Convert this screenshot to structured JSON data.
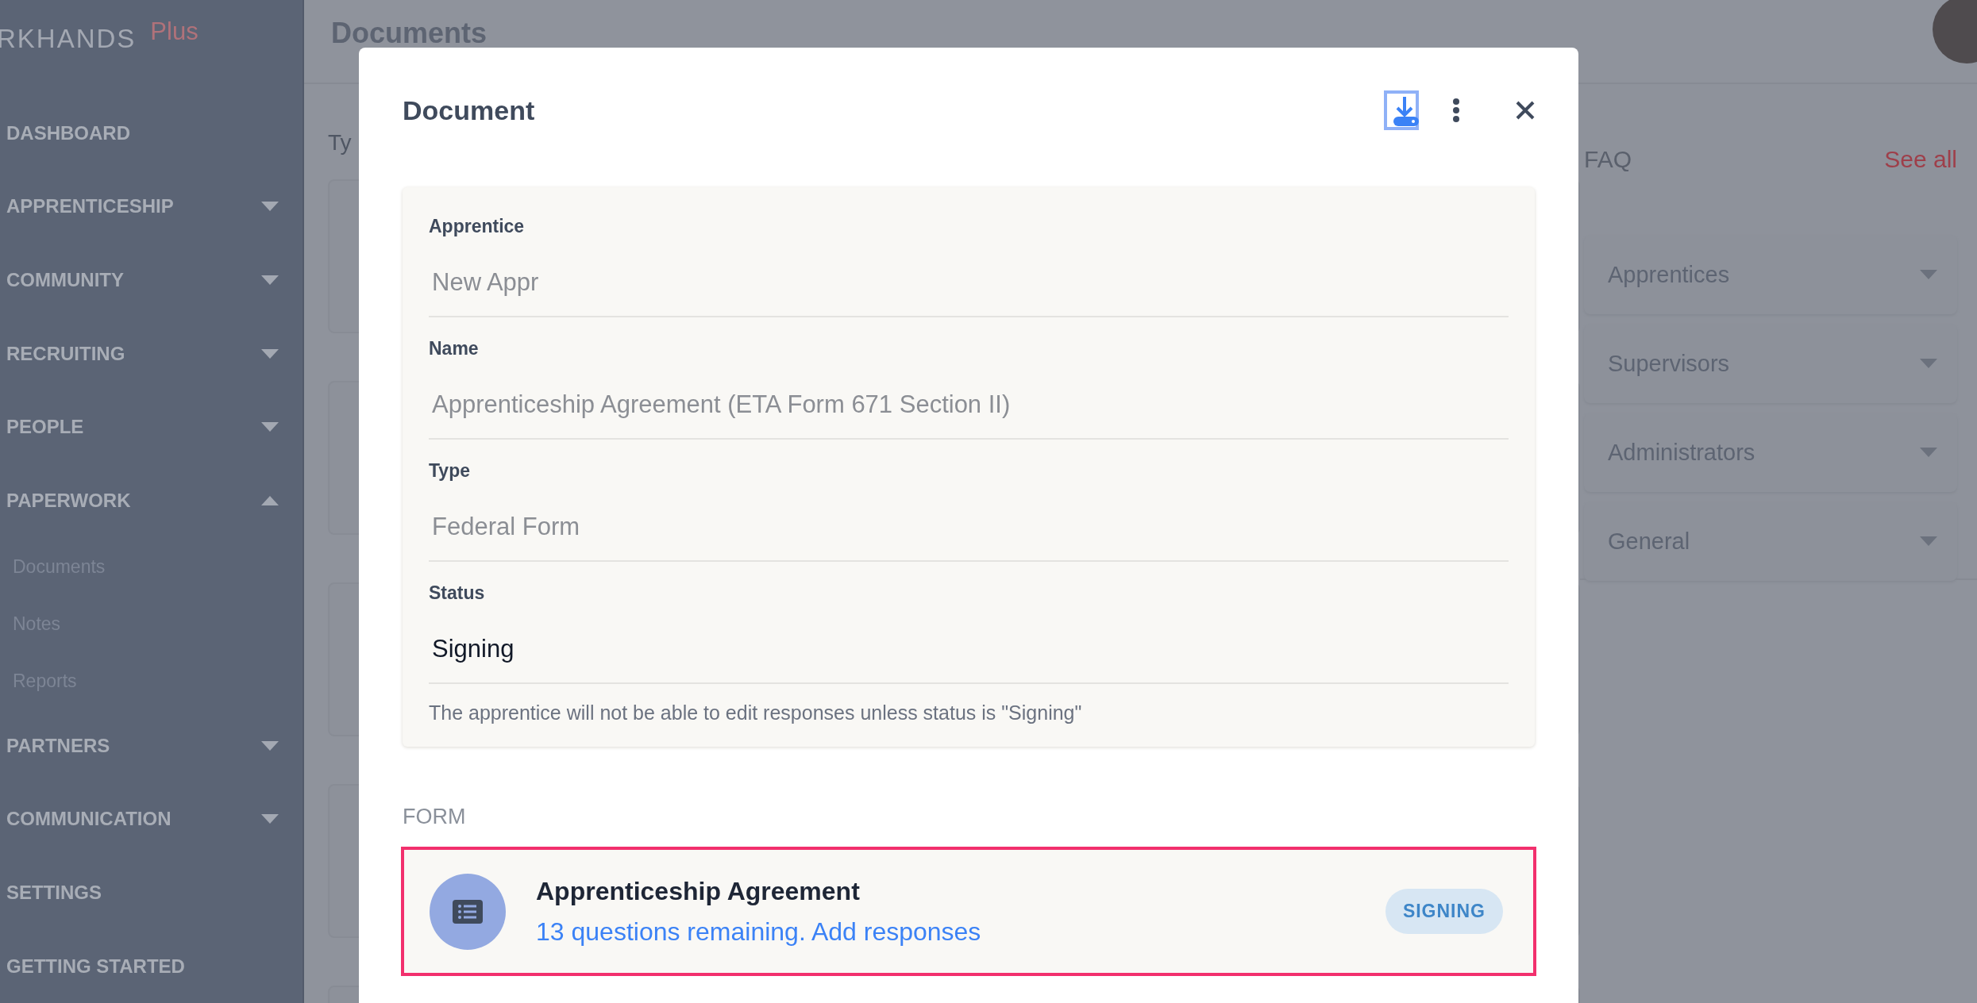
{
  "sidebar": {
    "logo": "RKHANDS",
    "logo_badge": "Plus",
    "items": [
      {
        "label": "DASHBOARD",
        "kind": "link"
      },
      {
        "label": "APPRENTICESHIP",
        "kind": "group",
        "expanded": false
      },
      {
        "label": "COMMUNITY",
        "kind": "group",
        "expanded": false
      },
      {
        "label": "RECRUITING",
        "kind": "group",
        "expanded": false
      },
      {
        "label": "PEOPLE",
        "kind": "group",
        "expanded": false
      },
      {
        "label": "PAPERWORK",
        "kind": "group",
        "expanded": true,
        "children": [
          {
            "label": "Documents"
          },
          {
            "label": "Notes"
          },
          {
            "label": "Reports"
          }
        ]
      },
      {
        "label": "PARTNERS",
        "kind": "group",
        "expanded": false
      },
      {
        "label": "COMMUNICATION",
        "kind": "group",
        "expanded": false
      },
      {
        "label": "SETTINGS",
        "kind": "link"
      },
      {
        "label": "GETTING STARTED",
        "kind": "link"
      }
    ]
  },
  "main": {
    "title": "Documents",
    "filter_label": "Ty"
  },
  "faq": {
    "title": "FAQ",
    "see_all": "See all",
    "items": [
      {
        "label": "Apprentices",
        "expanded": false
      },
      {
        "label": "Supervisors",
        "expanded": false
      },
      {
        "label": "Administrators",
        "expanded": false
      },
      {
        "label": "General",
        "expanded": false
      }
    ]
  },
  "modal": {
    "title": "Document",
    "fields": [
      {
        "label": "Apprentice",
        "value": "New Appr",
        "disabled": true
      },
      {
        "label": "Name",
        "value": "Apprenticeship Agreement (ETA Form 671 Section II)",
        "disabled": true
      },
      {
        "label": "Type",
        "value": "Federal Form",
        "disabled": true
      },
      {
        "label": "Status",
        "value": "Signing",
        "disabled": false
      }
    ],
    "hint": "The apprentice will not be able to edit responses unless status is \"Signing\"",
    "section_label": "FORM",
    "form_item": {
      "title": "Apprenticeship Agreement",
      "link": "13 questions remaining. Add responses",
      "badge": "SIGNING",
      "highlighted": true
    }
  }
}
